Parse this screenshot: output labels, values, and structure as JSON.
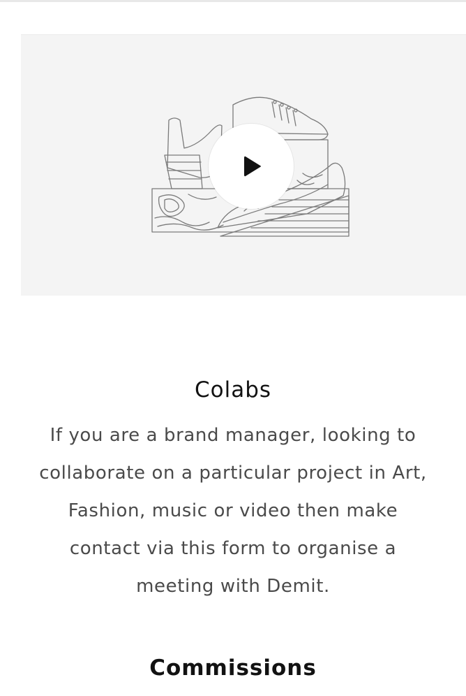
{
  "video": {
    "play_icon": "play-icon",
    "illustration": "shoes-on-wooden-blocks-illustration"
  },
  "colabs": {
    "title": "Colabs",
    "text": "If you are a brand manager, looking to collaborate on a particular project in Art, Fashion, music or video then make contact via this form to organise a meeting with Demit."
  },
  "commissions": {
    "title": "Commissions"
  }
}
